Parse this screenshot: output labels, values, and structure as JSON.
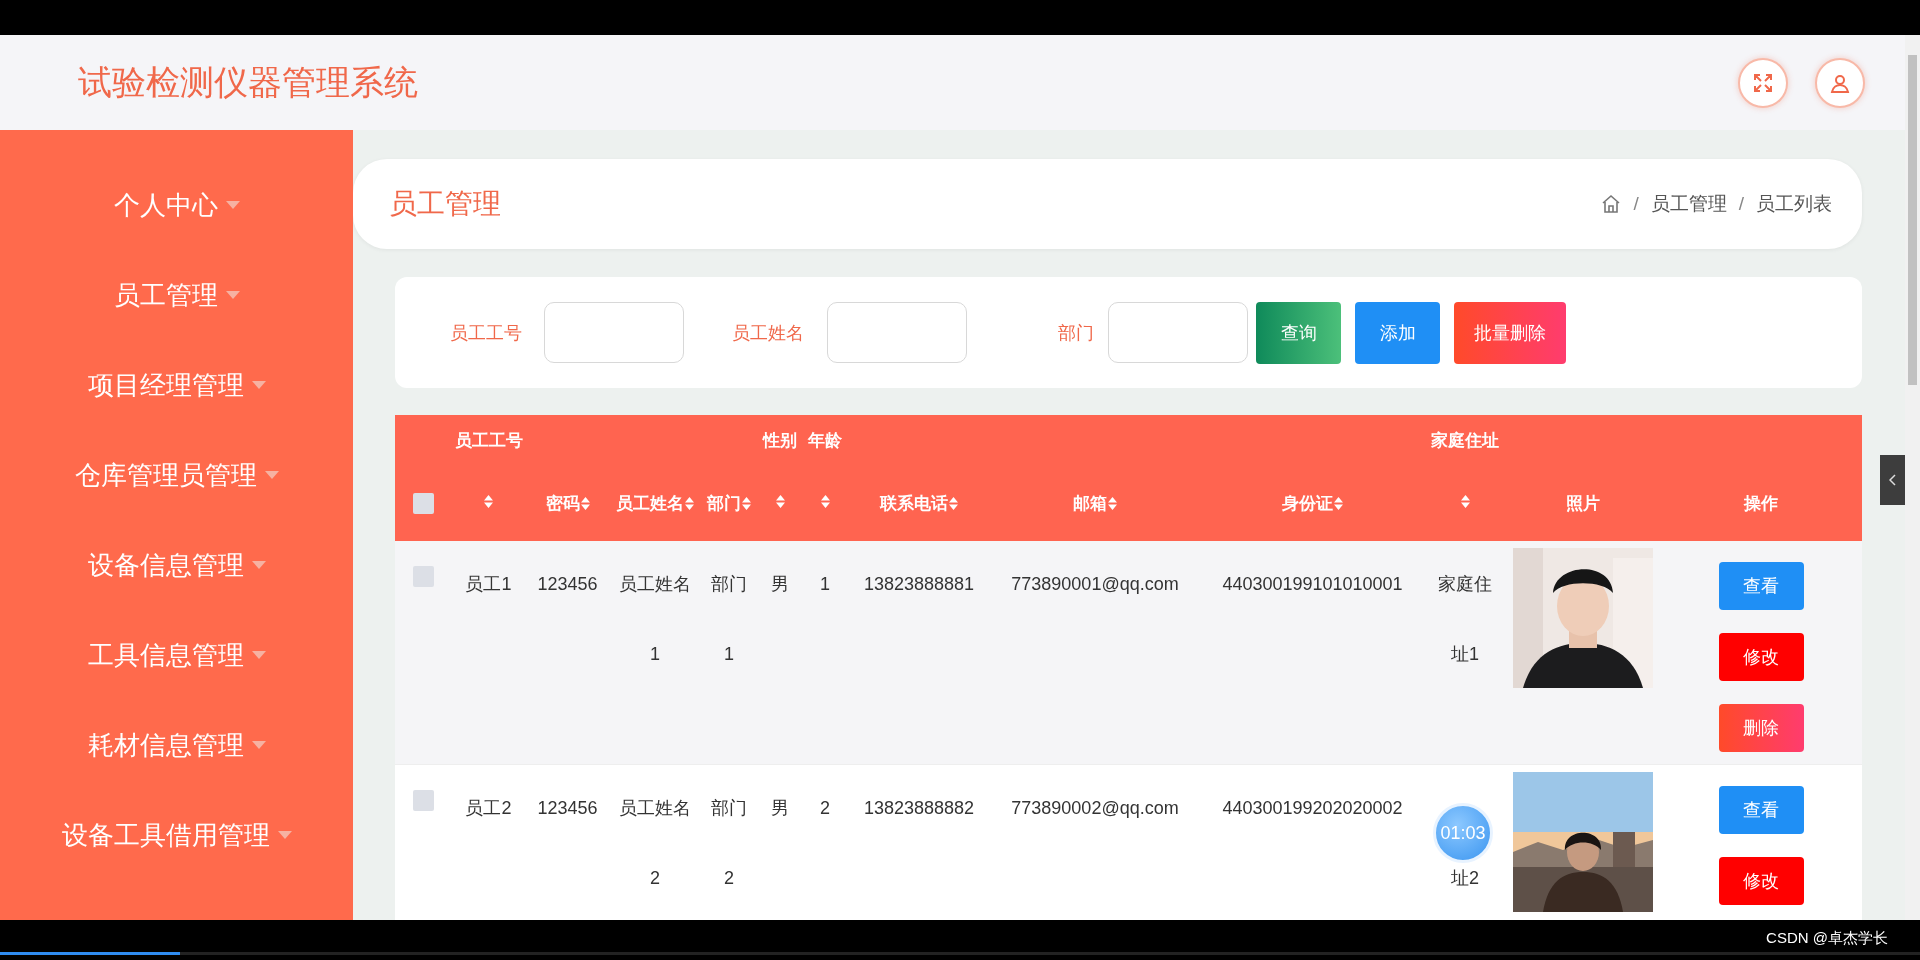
{
  "header": {
    "title": "试验检测仪器管理系统"
  },
  "sidebar": {
    "items": [
      {
        "label": "个人中心",
        "expanded": false
      },
      {
        "label": "员工管理",
        "expanded": false
      },
      {
        "label": "项目经理管理",
        "expanded": false
      },
      {
        "label": "仓库管理员管理",
        "expanded": false
      },
      {
        "label": "设备信息管理",
        "expanded": false
      },
      {
        "label": "工具信息管理",
        "expanded": false
      },
      {
        "label": "耗材信息管理",
        "expanded": false
      },
      {
        "label": "设备工具借用管理",
        "expanded": false
      }
    ]
  },
  "page_header": {
    "title": "员工管理",
    "separator": "/",
    "breadcrumb": [
      "员工管理",
      "员工列表"
    ]
  },
  "search": {
    "fields": [
      {
        "label": "员工工号"
      },
      {
        "label": "员工姓名"
      },
      {
        "label": "部门"
      }
    ],
    "buttons": [
      {
        "label": "查询",
        "kind": "search"
      },
      {
        "label": "添加",
        "kind": "add"
      },
      {
        "label": "批量删除",
        "kind": "delete"
      }
    ]
  },
  "table": {
    "all_checked": false,
    "columns": [
      {
        "upper": "员工工号",
        "sortable": true
      },
      {
        "label": "密码",
        "sortable": true
      },
      {
        "label": "员工姓名",
        "sortable": true
      },
      {
        "label": "部门",
        "sortable": true
      },
      {
        "upper": "性别",
        "sortable": true
      },
      {
        "upper": "年龄",
        "sortable": true
      },
      {
        "label": "联系电话",
        "sortable": true
      },
      {
        "label": "邮箱",
        "sortable": true
      },
      {
        "label": "身份证",
        "sortable": true
      },
      {
        "upper": "家庭住址",
        "sortable": true
      },
      {
        "label": "照片",
        "sortable": false
      },
      {
        "label": "操作",
        "sortable": false
      }
    ],
    "rows": [
      {
        "checked": false,
        "cells": [
          "员工1",
          "123456",
          "员工姓名1",
          "部门1",
          "男",
          "1",
          "13823888881",
          "773890001@qq.com",
          "440300199101010001",
          "家庭住址1"
        ],
        "actions": [
          {
            "label": "查看",
            "kind": "view"
          },
          {
            "label": "修改",
            "kind": "edit"
          },
          {
            "label": "删除",
            "kind": "delete"
          }
        ]
      },
      {
        "checked": false,
        "cells": [
          "员工2",
          "123456",
          "员工姓名2",
          "部门2",
          "男",
          "2",
          "13823888882",
          "773890002@qq.com",
          "440300199202020002",
          "址2"
        ],
        "address_covered": true,
        "actions": [
          {
            "label": "查看",
            "kind": "view"
          },
          {
            "label": "修改",
            "kind": "edit"
          }
        ]
      }
    ]
  },
  "timer_bubble": "01:03",
  "video_bar": {
    "level": 0.094,
    "credit": "CSDN @卓杰学长"
  }
}
